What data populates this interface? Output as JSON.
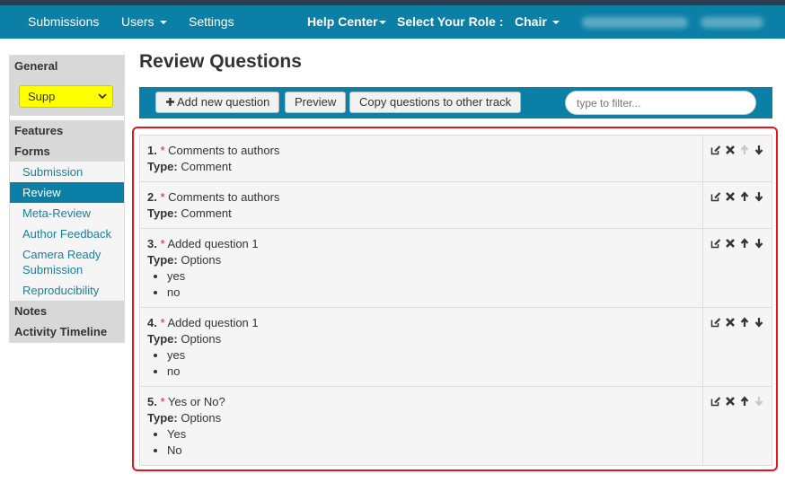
{
  "nav": {
    "submissions": "Submissions",
    "users": "Users",
    "settings": "Settings",
    "help_center": "Help Center",
    "select_role": "Select Your Role :",
    "role": "Chair"
  },
  "sidebar": {
    "general": "General",
    "track_value": "Supp",
    "features": "Features",
    "forms": "Forms",
    "form_links": [
      "Submission",
      "Review",
      "Meta-Review",
      "Author Feedback",
      "Camera Ready Submission",
      "Reproducibility"
    ],
    "notes": "Notes",
    "activity_timeline": "Activity Timeline"
  },
  "page": {
    "title": "Review Questions"
  },
  "toolbar": {
    "add_label": "Add new question",
    "preview_label": "Preview",
    "copy_label": "Copy questions to other track",
    "filter_placeholder": "type to filter..."
  },
  "questions": [
    {
      "num": "1.",
      "req": "*",
      "text": "Comments to authors",
      "type_label": "Type:",
      "type": "Comment",
      "options": []
    },
    {
      "num": "2.",
      "req": "*",
      "text": "Comments to authors",
      "type_label": "Type:",
      "type": "Comment",
      "options": []
    },
    {
      "num": "3.",
      "req": "*",
      "text": "Added question 1",
      "type_label": "Type:",
      "type": "Options",
      "options": [
        "yes",
        "no"
      ]
    },
    {
      "num": "4.",
      "req": "*",
      "text": "Added question 1",
      "type_label": "Type:",
      "type": "Options",
      "options": [
        "yes",
        "no"
      ]
    },
    {
      "num": "5.",
      "req": "*",
      "text": "Yes or No?",
      "type_label": "Type:",
      "type": "Options",
      "options": [
        "Yes",
        "No"
      ]
    }
  ],
  "colors": {
    "brand": "#0b7fa6",
    "highlight": "#ffff00",
    "annotation_border": "#e8141e",
    "required": "#e8141e"
  }
}
